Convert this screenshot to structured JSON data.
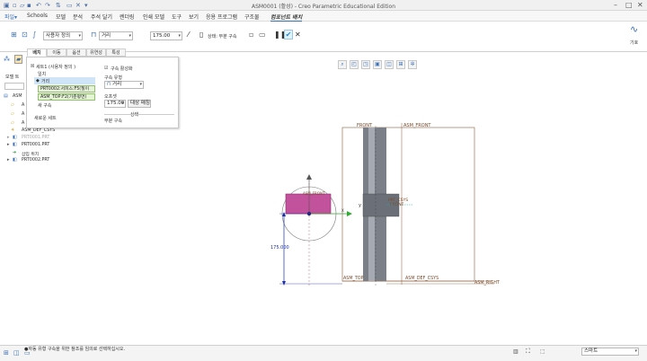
{
  "window": {
    "title": "ASM0001 (활성) - Creo Parametric Educational Edition"
  },
  "quick_access": {
    "icons": [
      "new-file-icon",
      "open-icon",
      "save-icon",
      "undo-icon",
      "redo-icon",
      "regenerate-icon",
      "windows-icon",
      "close-window-icon"
    ]
  },
  "menubar": {
    "items": [
      {
        "label": "파일▾"
      },
      {
        "label": "Schools"
      },
      {
        "label": "모델"
      },
      {
        "label": "분석"
      },
      {
        "label": "주석 달기"
      },
      {
        "label": "렌더링"
      },
      {
        "label": "인쇄 모델"
      },
      {
        "label": "도구"
      },
      {
        "label": "보기"
      },
      {
        "label": "응용 프로그램"
      },
      {
        "label": "구조물"
      },
      {
        "label": "컴포넌트 배치"
      }
    ]
  },
  "dashboard": {
    "constraint_set": "사용자 정의",
    "constraint_type": "거리",
    "offset_value": "175.00",
    "status_label": "상태: 부분 구속",
    "right_label": "기호"
  },
  "tabs": [
    {
      "label": "배치"
    },
    {
      "label": "이동"
    },
    {
      "label": "옵션"
    },
    {
      "label": "유연성"
    },
    {
      "label": "특성"
    }
  ],
  "panel": {
    "set_label": "세트1 (사용자 정의 )",
    "constraint_header": "일치",
    "constraint_active": "거리",
    "ref1": "PRT0002:서피스:F5(질이",
    "ref2": "ASM_TOP:F2(기준평면)",
    "new_constraint": "새 구속",
    "new_set": "새로운 세트",
    "enable_constraint": "구속 활성화",
    "constraint_type_label": "구속 유형",
    "constraint_type_value": "거리",
    "offset_label": "오프셋",
    "offset_value": "175.00",
    "flip_button": "대상 매칭",
    "status_section": "상태",
    "status_value": "부분 구속"
  },
  "tree": {
    "header": "모델 트",
    "items": [
      {
        "label": "ASM"
      },
      {
        "label": "A"
      },
      {
        "label": "A"
      },
      {
        "label": "A"
      },
      {
        "label": "ASM_DEF_CSYS"
      },
      {
        "label": "PRT0001.PRT"
      },
      {
        "label": "PRT0001.PRT"
      },
      {
        "label": "삽입 위치"
      },
      {
        "label": "PRT0002.PRT"
      }
    ]
  },
  "graphics": {
    "labels": {
      "asm_front_top": "ASM_FRONT",
      "front_left": "FRONT",
      "asm_front_small": "ASM_FRONT",
      "prt_csys": "PRT_CSYS",
      "front2": "FRONT",
      "asm_top": "ASM_TOP",
      "asm_def_csys": "ASM_DEF_CSYS",
      "asm_right": "ASM_RIGHT",
      "dimension": "175.000",
      "axis_y": "y",
      "axis_x": "X"
    }
  },
  "statusbar": {
    "message": "●자동 유형 구속을 위한 참조를 임의로 선택하십시오.",
    "filter": "스마트"
  },
  "colors": {
    "accent": "#3a70b8",
    "placement_part": "#c2529c",
    "dimension": "#1a2fb0",
    "confirm": "#2a8ad8"
  }
}
